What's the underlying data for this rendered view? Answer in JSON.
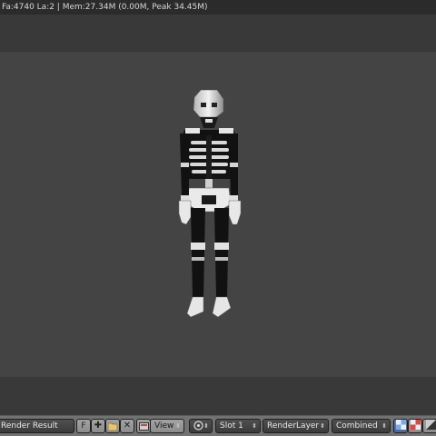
{
  "status": {
    "text": "Fa:4740 La:2 | Mem:27.34M (0.00M, Peak 34.45M)"
  },
  "header": {
    "image_name": "Render Result",
    "fake_user_label": "F",
    "view_menu": "View",
    "slot": "Slot 1",
    "render_layer": "RenderLayer",
    "pass": "Combined",
    "icons": [
      "image-editor-icon",
      "new-image-icon",
      "open-image-icon",
      "close-icon",
      "pivot-icon",
      "alpha-icon",
      "checker-icon",
      "scopes-icon"
    ]
  },
  "colors": {
    "background": "#393939",
    "render_backdrop": "#444444",
    "header": "#727272",
    "active_button": "#5a7fb5"
  }
}
